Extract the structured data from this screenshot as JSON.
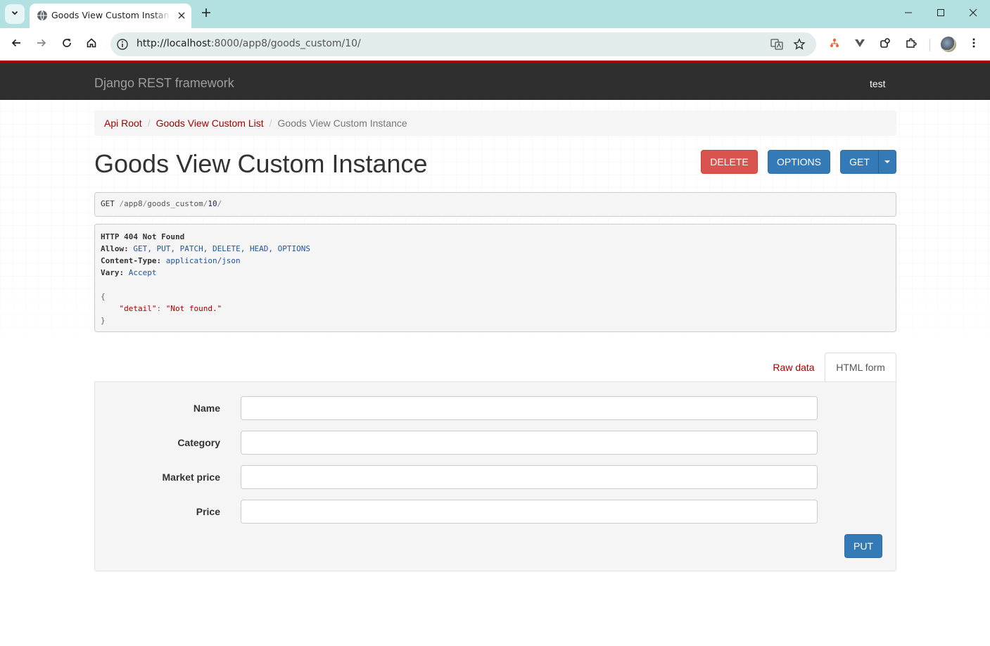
{
  "browser": {
    "tab_title": "Goods View Custom Instance",
    "url_host": "http://localhost",
    "url_rest": ":8000/app8/goods_custom/10/"
  },
  "navbar": {
    "brand": "Django REST framework",
    "user": "test"
  },
  "breadcrumb": {
    "items": [
      "Api Root",
      "Goods View Custom List",
      "Goods View Custom Instance"
    ],
    "separator": "/"
  },
  "page_title": "Goods View Custom Instance",
  "actions": {
    "delete": "DELETE",
    "options": "OPTIONS",
    "get": "GET"
  },
  "request": {
    "method": "GET",
    "path_parts": [
      "/",
      "app8",
      "/",
      "goods_custom",
      "/",
      "10",
      "/"
    ]
  },
  "response": {
    "status": "HTTP 404 Not Found",
    "allow_key": "Allow:",
    "allow_value": "GET, PUT, PATCH, DELETE, HEAD, OPTIONS",
    "content_type_key": "Content-Type:",
    "content_type_value": "application/json",
    "vary_key": "Vary:",
    "vary_value": "Accept",
    "body_open": "{",
    "body_key": "\"detail\"",
    "body_colon": ": ",
    "body_value": "\"Not found.\"",
    "body_close": "}"
  },
  "form_tabs": {
    "raw": "Raw data",
    "html": "HTML form"
  },
  "form": {
    "fields": [
      {
        "label": "Name",
        "value": ""
      },
      {
        "label": "Category",
        "value": ""
      },
      {
        "label": "Market price",
        "value": ""
      },
      {
        "label": "Price",
        "value": ""
      }
    ],
    "submit": "PUT"
  },
  "colors": {
    "navbar_bg": "#2f2f2f",
    "accent_red": "#a30000",
    "primary": "#337ab7",
    "danger": "#d9534f",
    "tabstrip": "#b3e0e0"
  }
}
